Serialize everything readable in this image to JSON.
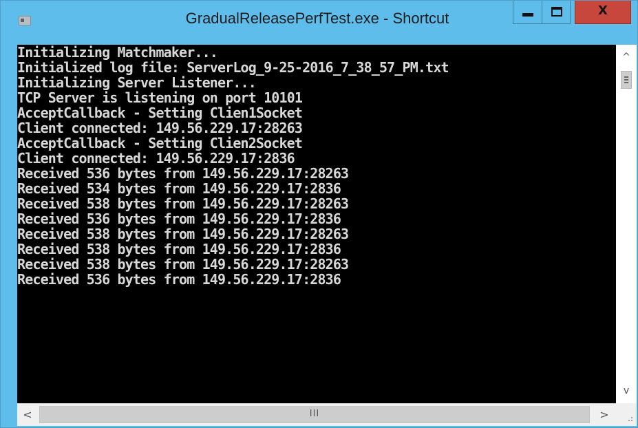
{
  "window": {
    "title": "GradualReleasePerfTest.exe - Shortcut",
    "icon": "console-app-icon",
    "controls": {
      "minimize": "minimize-icon",
      "maximize": "maximize-icon",
      "close_glyph": "X"
    }
  },
  "console": {
    "lines": [
      "Initializing Matchmaker...",
      "Initialized log file: ServerLog_9-25-2016_7_38_57_PM.txt",
      "Initializing Server Listener...",
      "TCP Server is listening on port 10101",
      "AcceptCallback - Setting Clien1Socket",
      "Client connected: 149.56.229.17:28263",
      "AcceptCallback - Setting Clien2Socket",
      "Client connected: 149.56.229.17:2836",
      "Received 536 bytes from 149.56.229.17:28263",
      "Received 534 bytes from 149.56.229.17:2836",
      "Received 538 bytes from 149.56.229.17:28263",
      "Received 536 bytes from 149.56.229.17:2836",
      "Received 538 bytes from 149.56.229.17:28263",
      "Received 538 bytes from 149.56.229.17:2836",
      "Received 538 bytes from 149.56.229.17:28263",
      "Received 536 bytes from 149.56.229.17:2836"
    ]
  },
  "scrollbars": {
    "vertical": {
      "up_glyph": "^",
      "down_glyph": "v"
    },
    "horizontal": {
      "left_glyph": "<",
      "right_glyph": ">",
      "thumb_grip": "III"
    }
  },
  "colors": {
    "titlebar": "#5fbdec",
    "close_button": "#c7473c",
    "console_bg": "#000000",
    "console_text": "#d8d8d8"
  }
}
